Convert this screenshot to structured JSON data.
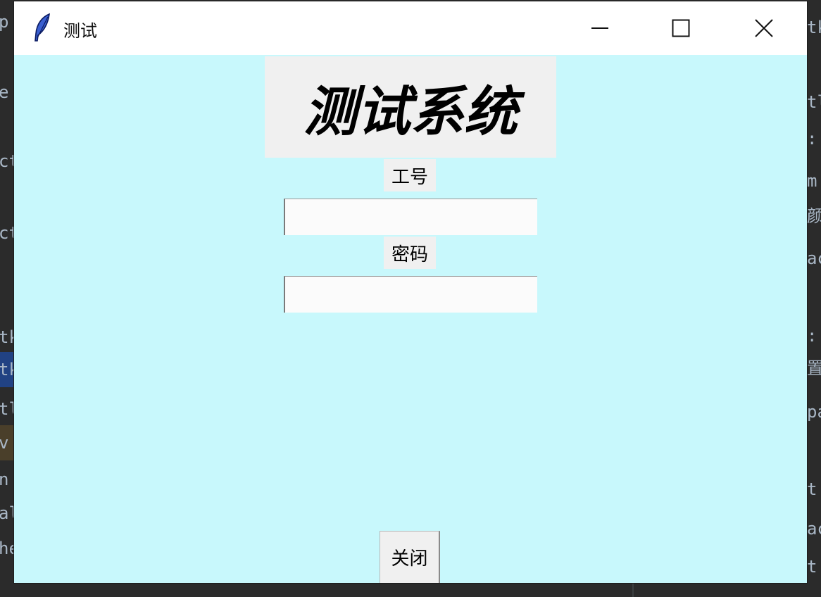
{
  "window": {
    "title": "测试",
    "heading": "测试系统",
    "id_label": "工号",
    "id_value": "",
    "password_label": "密码",
    "password_value": "",
    "close_button_label": "关闭"
  },
  "background_editor": {
    "left_fragments": [
      "p",
      "e",
      "ct",
      "ct",
      "tk",
      "tk",
      "tle",
      "v",
      "n",
      "al",
      "he"
    ],
    "right_fragments": [
      "tk",
      "tl",
      ":",
      "m",
      "颜",
      "ac",
      ":",
      "置",
      "pa",
      "t",
      "ac",
      "t"
    ]
  },
  "colors": {
    "client_background": "#c8f8fc",
    "widget_background": "#f0f0f0",
    "titlebar": "#ffffff",
    "editor_background": "#2b2b2b"
  },
  "icons": {
    "app": "feather-icon",
    "minimize": "minimize-icon",
    "maximize": "maximize-icon",
    "close": "close-icon"
  }
}
